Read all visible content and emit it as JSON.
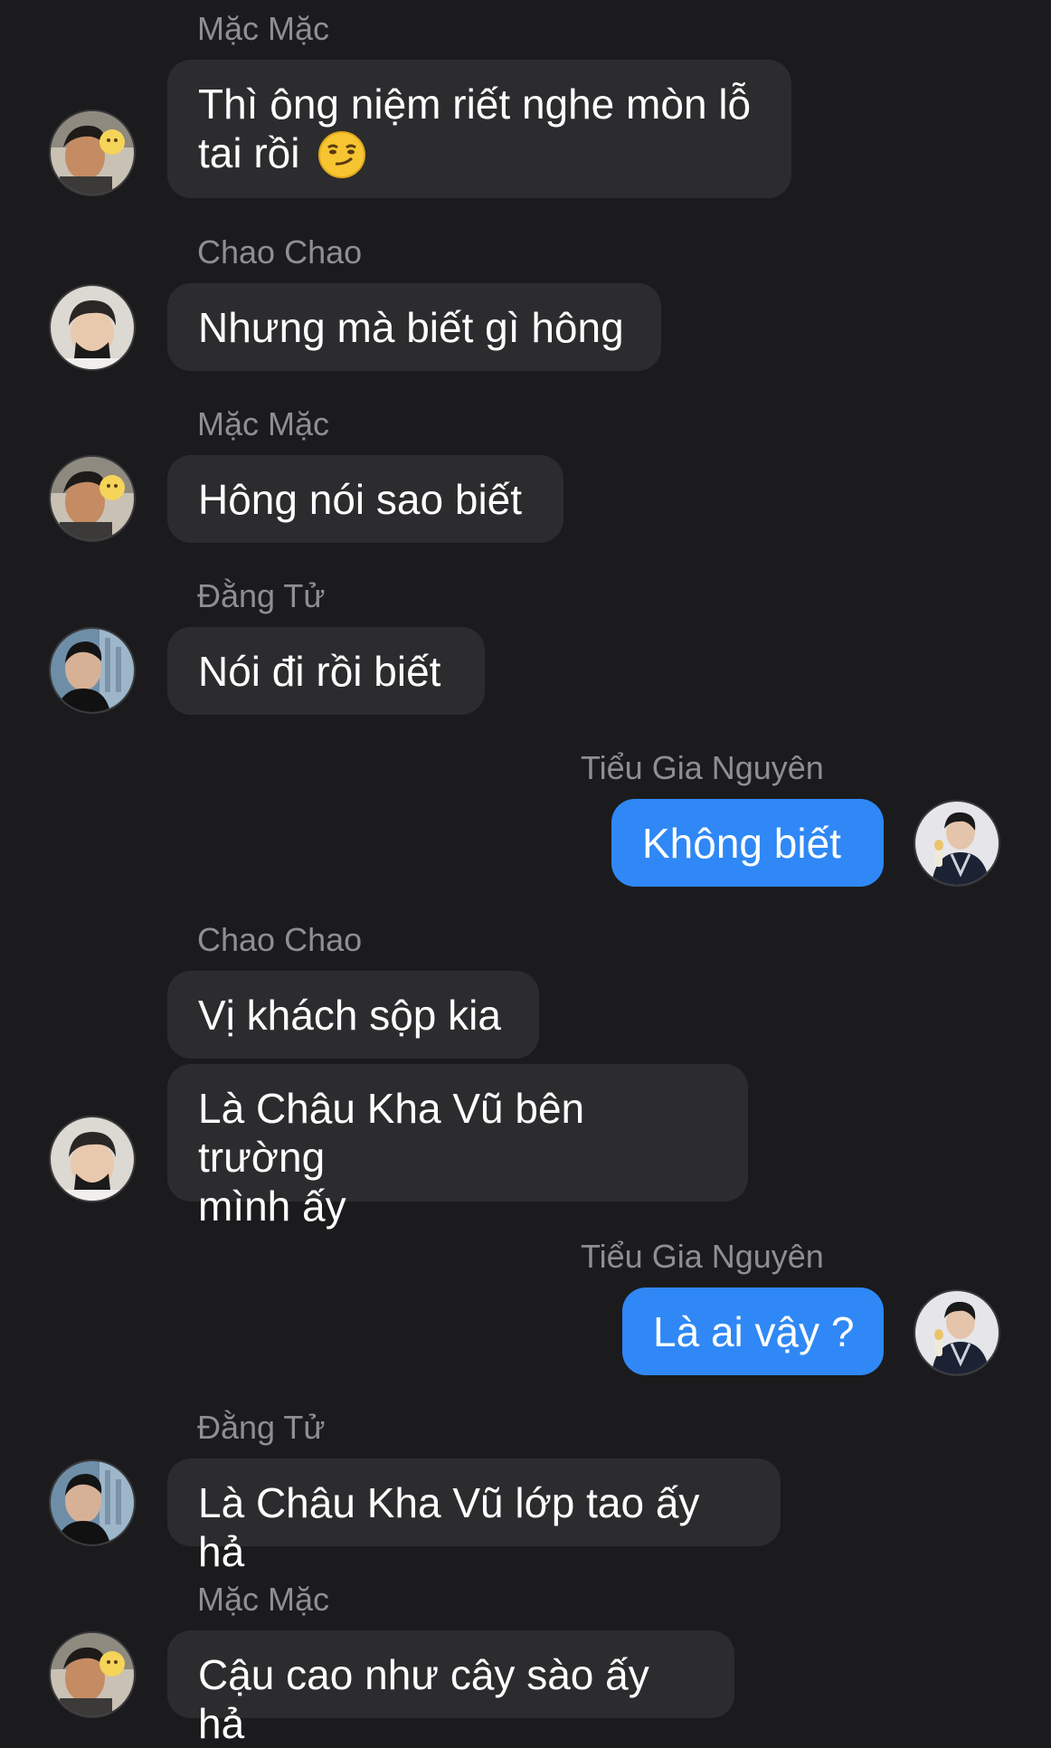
{
  "conversation": {
    "messages": [
      {
        "sender": "Mặc Mặc",
        "text": "Thì ông niệm riết nghe mòn lỗ\ntai rồi",
        "emoji": "smirking-face",
        "direction": "incoming",
        "avatar": "mac-mac"
      },
      {
        "sender": "Chao Chao",
        "text": "Nhưng mà biết gì hông",
        "direction": "incoming",
        "avatar": "chao-chao"
      },
      {
        "sender": "Mặc Mặc",
        "text": "Hông nói sao biết",
        "direction": "incoming",
        "avatar": "mac-mac"
      },
      {
        "sender": "Đằng Tử",
        "text": "Nói đi rồi biết",
        "direction": "incoming",
        "avatar": "dang-tu"
      },
      {
        "sender": "Tiểu Gia Nguyên",
        "text": "Không biết",
        "direction": "outgoing",
        "avatar": "tieu-gia-nguyen"
      },
      {
        "sender": "Chao Chao",
        "text": "Vị khách sộp kia",
        "direction": "incoming",
        "avatar": ""
      },
      {
        "sender": "",
        "text": "Là Châu Kha Vũ bên trường\nmình ấy",
        "direction": "incoming",
        "avatar": "chao-chao"
      },
      {
        "sender": "Tiểu Gia Nguyên",
        "text": "Là ai vậy ?",
        "direction": "outgoing",
        "avatar": "tieu-gia-nguyen"
      },
      {
        "sender": "Đằng Tử",
        "text": "Là Châu Kha Vũ lớp tao ấy hả",
        "direction": "incoming",
        "avatar": "dang-tu"
      },
      {
        "sender": "Mặc Mặc",
        "text": "Cậu cao như cây sào ấy hả",
        "direction": "incoming",
        "avatar": "mac-mac"
      }
    ]
  },
  "colors": {
    "background": "#1b1b1d",
    "incoming_bubble": "#2c2c2e",
    "outgoing_bubble": "#2f88f5",
    "sender_name": "#8e8e93",
    "message_text": "#ffffff"
  }
}
